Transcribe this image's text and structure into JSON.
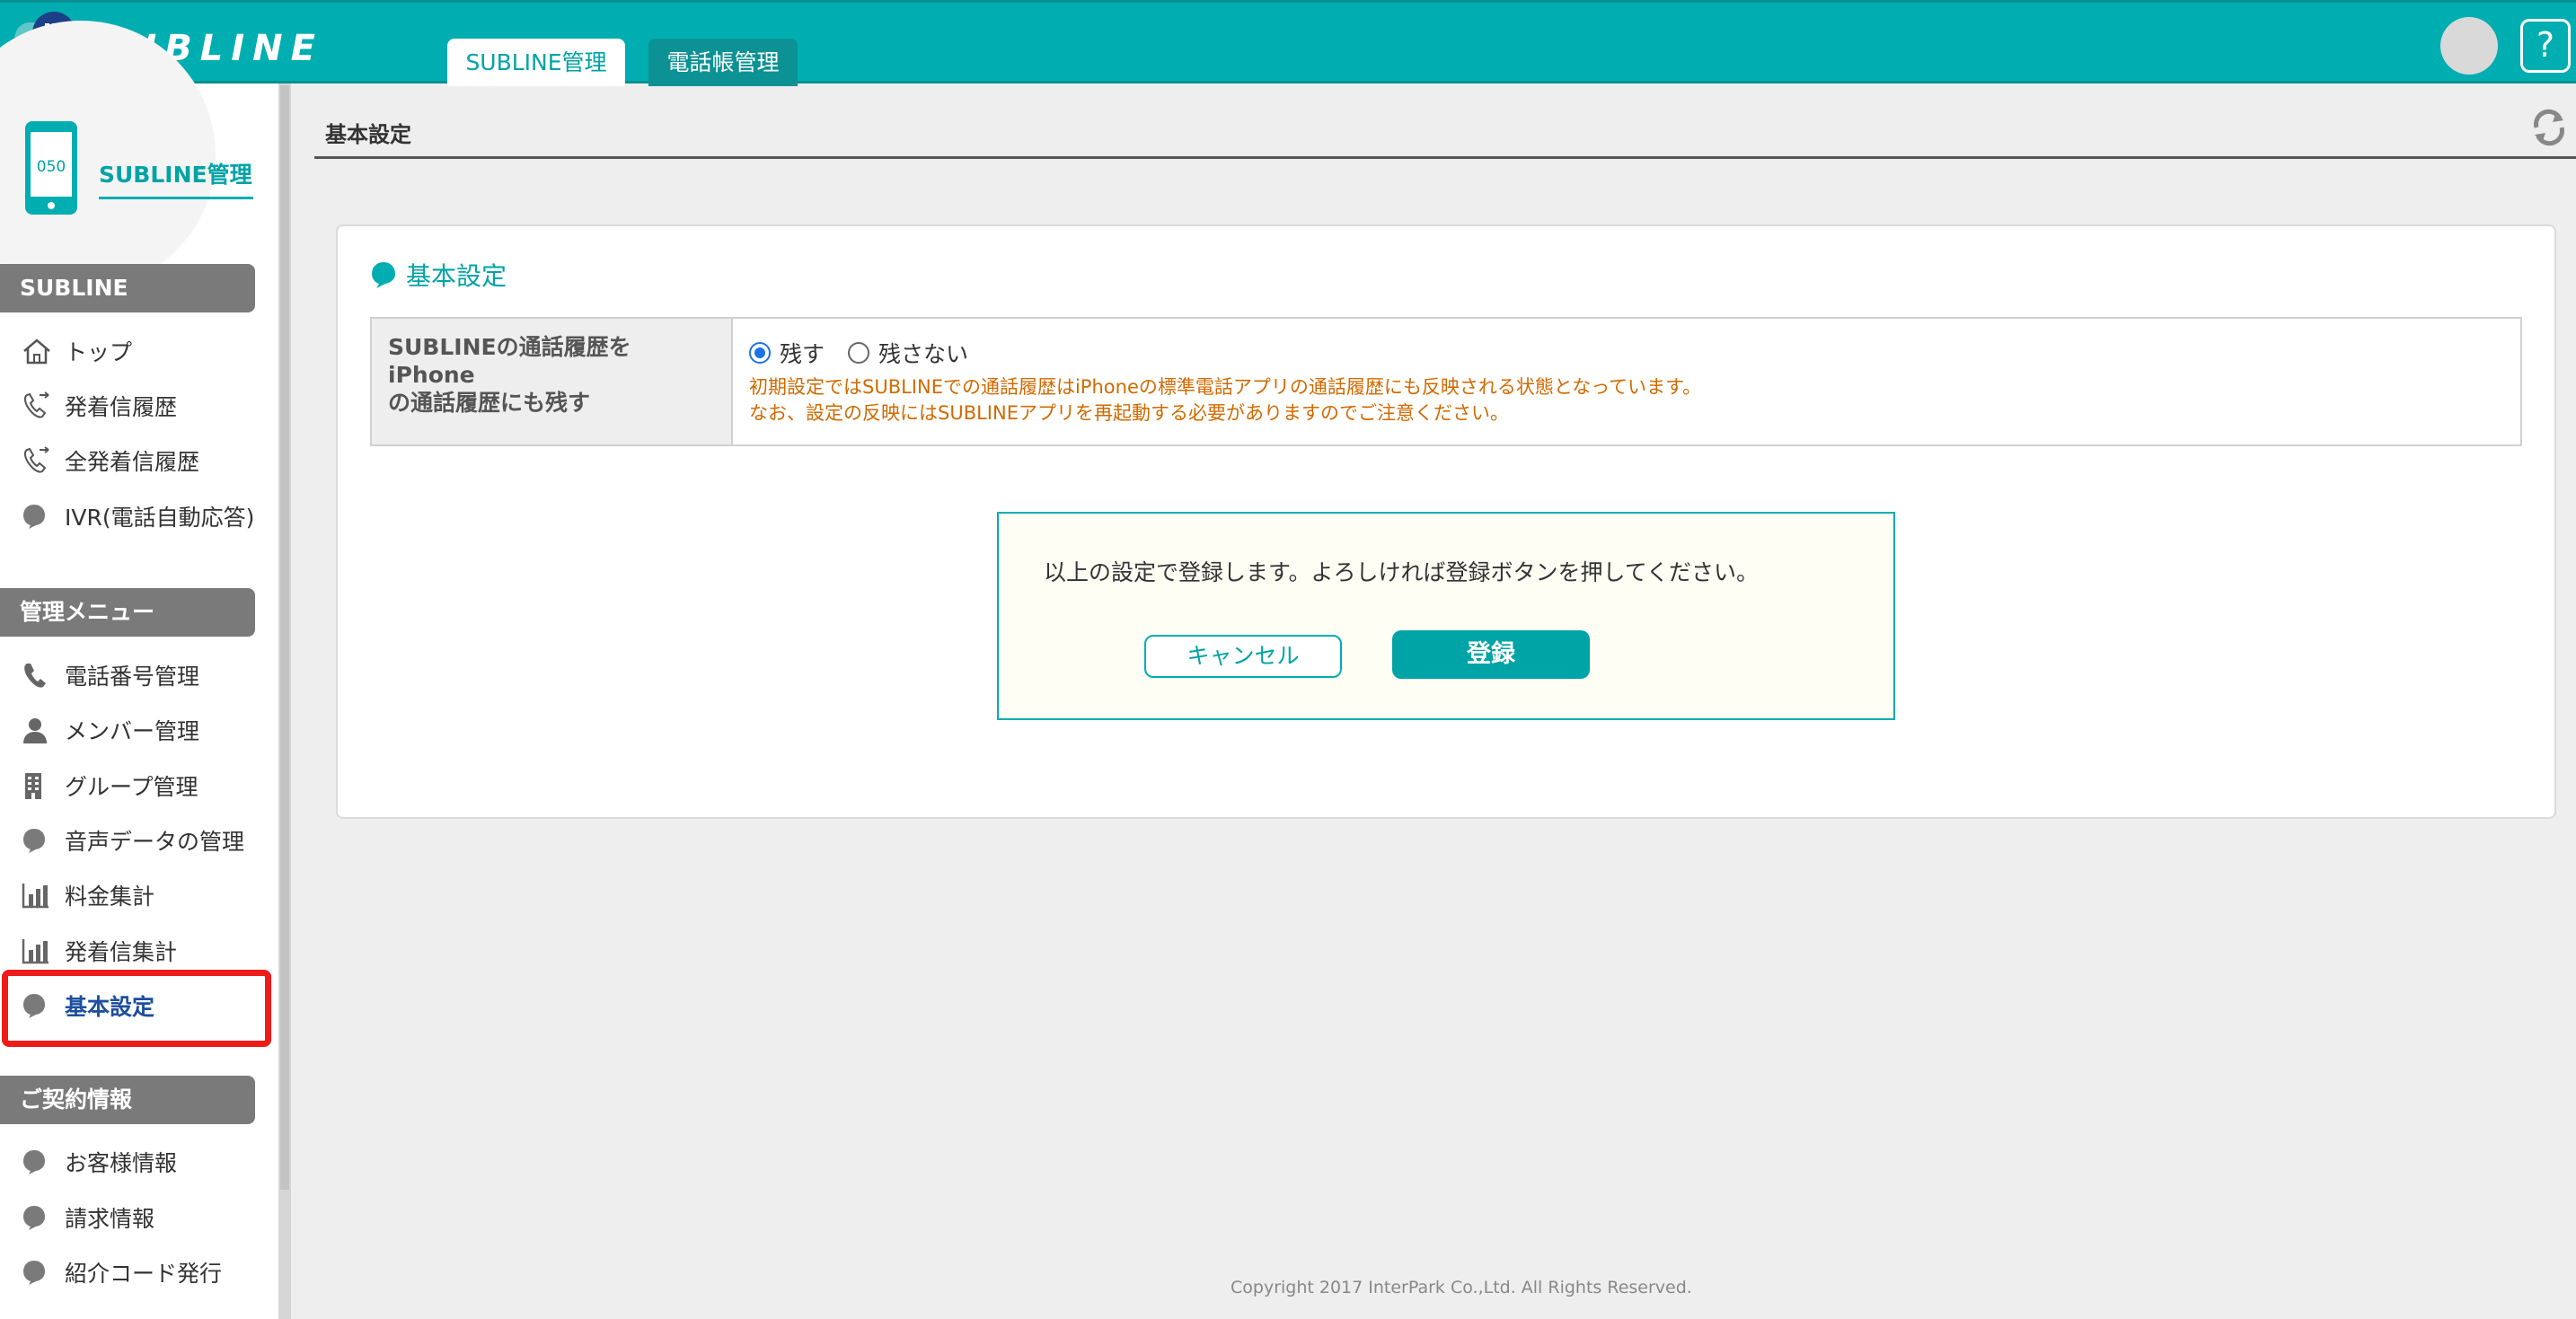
{
  "header": {
    "logo_text": "SUBLINE",
    "tabs": [
      {
        "label": "SUBLINE管理",
        "active": true
      },
      {
        "label": "電話帳管理",
        "active": false
      }
    ],
    "help_label": "?"
  },
  "sidebar": {
    "title": "SUBLINE管理",
    "phone_label": "050",
    "sections": [
      {
        "header": "SUBLINE",
        "items": [
          {
            "label": "トップ",
            "icon": "home-icon"
          },
          {
            "label": "発着信履歴",
            "icon": "phone-history-icon"
          },
          {
            "label": "全発着信履歴",
            "icon": "phone-history-icon"
          },
          {
            "label": "IVR(電話自動応答)",
            "icon": "bubble-icon"
          }
        ]
      },
      {
        "header": "管理メニュー",
        "items": [
          {
            "label": "電話番号管理",
            "icon": "phone-icon"
          },
          {
            "label": "メンバー管理",
            "icon": "user-icon"
          },
          {
            "label": "グループ管理",
            "icon": "building-icon"
          },
          {
            "label": "音声データの管理",
            "icon": "bubble-icon"
          },
          {
            "label": "料金集計",
            "icon": "bar-chart-icon"
          },
          {
            "label": "発着信集計",
            "icon": "bar-chart-icon"
          },
          {
            "label": "基本設定",
            "icon": "bubble-icon",
            "active": true
          }
        ]
      },
      {
        "header": "ご契約情報",
        "items": [
          {
            "label": "お客様情報",
            "icon": "bubble-icon"
          },
          {
            "label": "請求情報",
            "icon": "bubble-icon"
          },
          {
            "label": "紹介コード発行",
            "icon": "bubble-icon"
          }
        ]
      }
    ]
  },
  "main": {
    "page_title": "基本設定",
    "card_title": "基本設定",
    "setting": {
      "label": "SUBLINEの通話履歴をiPhoneの通話履歴にも残す",
      "label_line1": "SUBLINEの通話履歴をiPhone",
      "label_line2": "の通話履歴にも残す",
      "options": [
        {
          "label": "残す",
          "checked": true
        },
        {
          "label": "残さない",
          "checked": false
        }
      ],
      "note_line1": "初期設定ではSUBLINEでの通話履歴はiPhoneの標準電話アプリの通話履歴にも反映される状態となっています。",
      "note_line2": "なお、設定の反映にはSUBLINEアプリを再起動する必要がありますのでご注意ください。"
    },
    "confirm": {
      "message": "以上の設定で登録します。よろしければ登録ボタンを押してください。",
      "cancel_label": "キャンセル",
      "register_label": "登録"
    },
    "copyright": "Copyright 2017 InterPark Co.,Ltd. All Rights Reserved."
  },
  "colors": {
    "brand": "#00adb0",
    "brand_dark": "#0a8f92",
    "section_header": "#7a7a7a",
    "note": "#d06a00",
    "highlight": "#ee1b1b"
  }
}
